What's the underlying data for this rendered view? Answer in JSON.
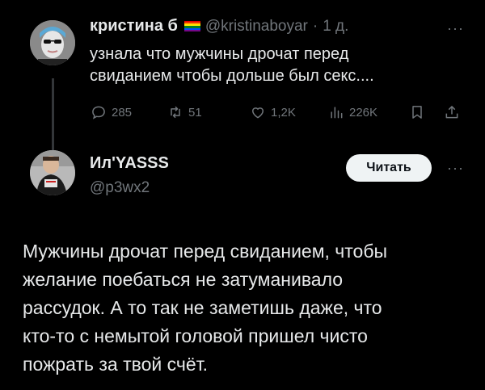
{
  "tweet1": {
    "name": "кристина б",
    "handle": "@kristinaboyar",
    "sep": "·",
    "time": "1 д.",
    "more": "···",
    "text_line1": "узнала что мужчины дрочат перед",
    "text_line2": "свиданием чтобы дольше был секс....",
    "metrics": {
      "replies": "285",
      "reposts": "51",
      "likes": "1,2K",
      "views": "226K"
    },
    "flag_colors": [
      "#e40303",
      "#ff8c00",
      "#ffed00",
      "#008026",
      "#004dff",
      "#750787"
    ]
  },
  "tweet2": {
    "name": "Ил'YASSS",
    "handle": "@p3wx2",
    "follow_label": "Читать",
    "more": "···",
    "text_lines": [
      "Мужчины дрочат перед свиданием, чтобы",
      "желание поебаться не затуманивало",
      "рассудок. А то так не заметишь даже, что",
      "кто-то с немытой головой пришел чисто",
      "пожрать за твой счёт."
    ]
  }
}
